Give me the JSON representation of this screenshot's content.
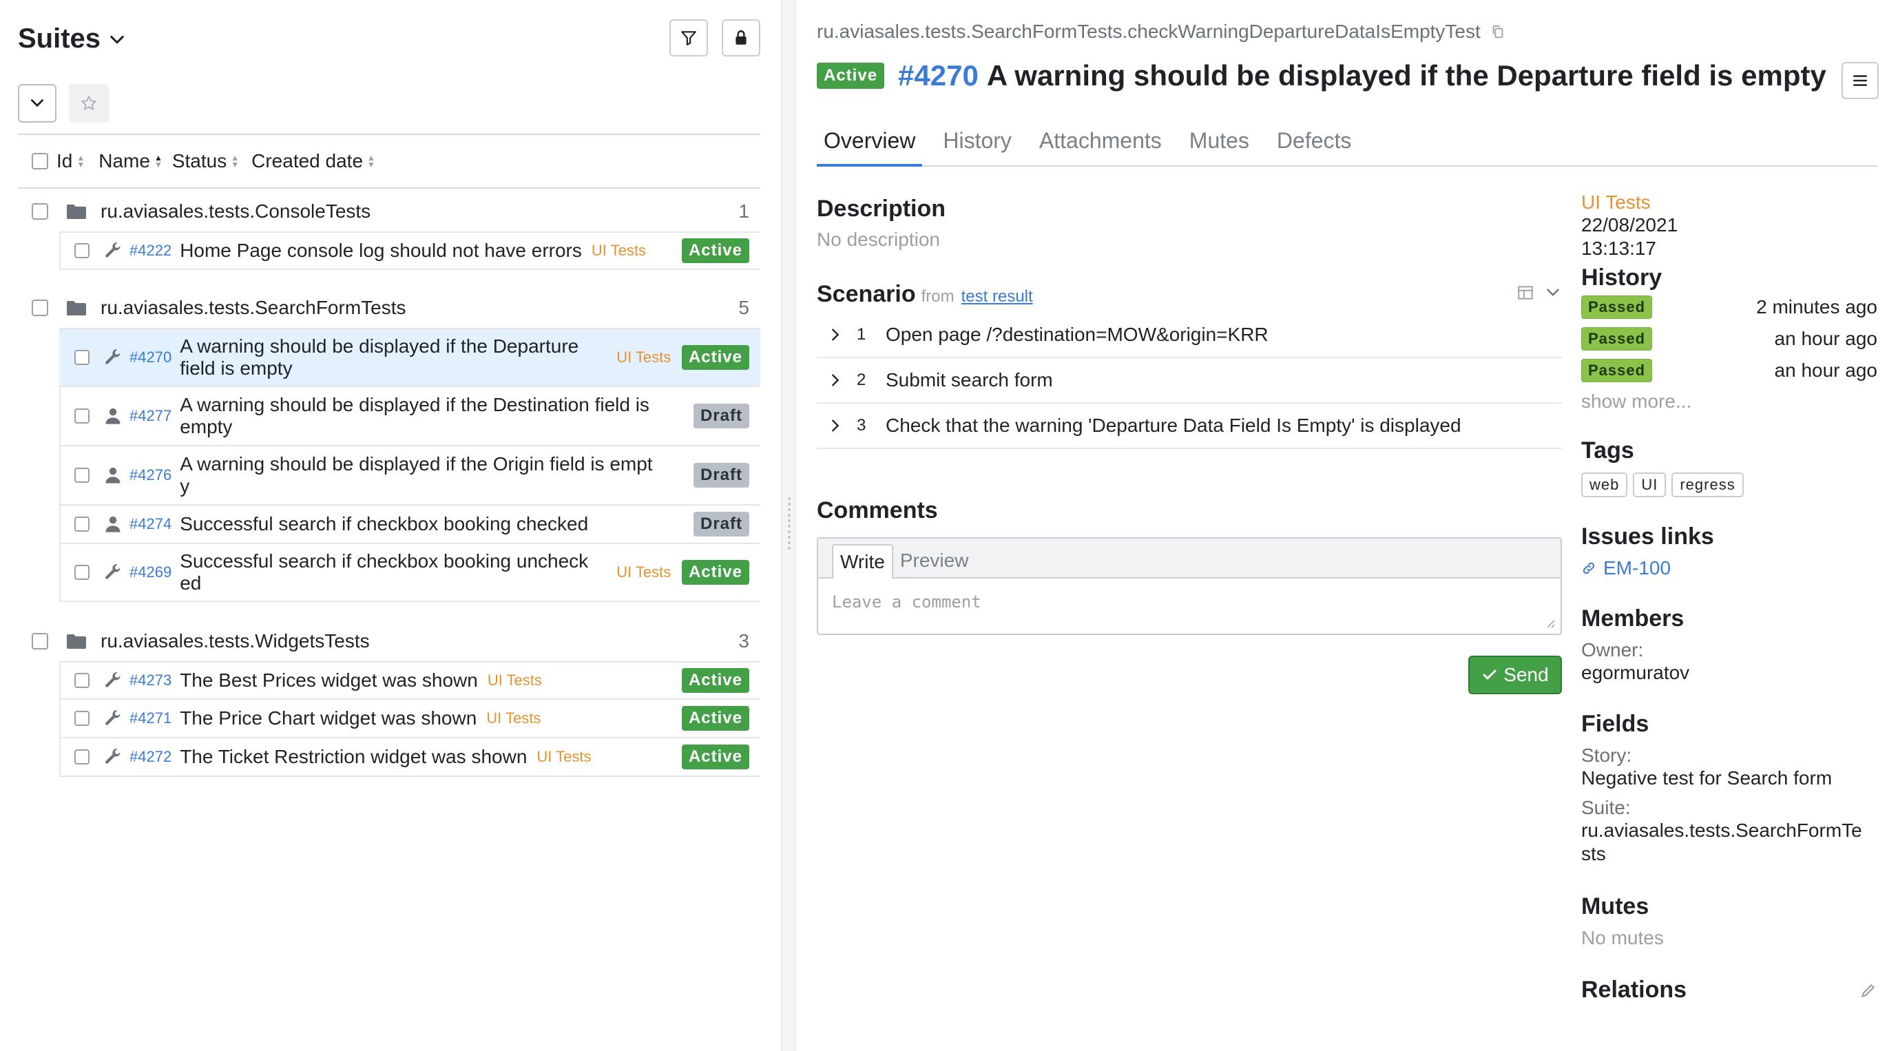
{
  "left": {
    "title": "Suites",
    "columns": [
      "Id",
      "Name",
      "Status",
      "Created date"
    ],
    "suites": [
      {
        "name": "ru.aviasales.tests.ConsoleTests",
        "count": "1",
        "cases": [
          {
            "id": "#4222",
            "name": "Home Page console log should not have errors",
            "layer": "UI Tests",
            "status": "Active",
            "icon": "wrench-icon"
          }
        ]
      },
      {
        "name": "ru.aviasales.tests.SearchFormTests",
        "count": "5",
        "cases": [
          {
            "id": "#4270",
            "name_line1": "A warning should be displayed if the Departure",
            "name_line2": "field is empty",
            "layer": "UI Tests",
            "status": "Active",
            "icon": "wrench-icon"
          },
          {
            "id": "#4277",
            "name_line1": "A warning should be displayed if the Destination field is",
            "name_line2": "empty",
            "layer": "",
            "status": "Draft",
            "icon": "person-icon"
          },
          {
            "id": "#4276",
            "name_line1": "A warning should be displayed if the Origin field is empt",
            "name_line2": "y",
            "layer": "",
            "status": "Draft",
            "icon": "person-icon"
          },
          {
            "id": "#4274",
            "name": "Successful search if checkbox booking checked",
            "layer": "",
            "status": "Draft",
            "icon": "person-icon"
          },
          {
            "id": "#4269",
            "name_line1": "Successful search if checkbox booking uncheck",
            "name_line2": "ed",
            "layer": "UI Tests",
            "status": "Active",
            "icon": "wrench-icon"
          }
        ]
      },
      {
        "name": "ru.aviasales.tests.WidgetsTests",
        "count": "3",
        "cases": [
          {
            "id": "#4273",
            "name": "The Best Prices widget was shown",
            "layer": "UI Tests",
            "status": "Active",
            "icon": "wrench-icon"
          },
          {
            "id": "#4271",
            "name": "The Price Chart widget was shown",
            "layer": "UI Tests",
            "status": "Active",
            "icon": "wrench-icon"
          },
          {
            "id": "#4272",
            "name": "The Ticket Restriction widget was shown",
            "layer": "UI Tests",
            "status": "Active",
            "icon": "wrench-icon"
          }
        ]
      }
    ]
  },
  "detail": {
    "full_name": "ru.aviasales.tests.SearchFormTests.checkWarningDepartureDataIsEmptyTest",
    "status": "Active",
    "id": "#4270",
    "title": "A warning should be displayed if the Departure field is empty",
    "tabs": [
      "Overview",
      "History",
      "Attachments",
      "Mutes",
      "Defects"
    ],
    "description_heading": "Description",
    "description": "No description",
    "scenario_heading": "Scenario",
    "scenario_from": "from",
    "scenario_link": "test result",
    "steps": [
      {
        "num": "1",
        "text": "Open page /?destination=MOW&origin=KRR"
      },
      {
        "num": "2",
        "text": "Submit search form"
      },
      {
        "num": "3",
        "text": "Check that the warning 'Departure Data Field Is Empty' is displayed"
      }
    ],
    "comments_heading": "Comments",
    "comment_tab_write": "Write",
    "comment_tab_preview": "Preview",
    "comment_placeholder": "Leave a comment",
    "send_label": "Send"
  },
  "side": {
    "layer": "UI Tests",
    "created_date": "22/08/2021",
    "created_time": "13:13:17",
    "history_heading": "History",
    "history": [
      {
        "status": "Passed",
        "time": "2 minutes ago"
      },
      {
        "status": "Passed",
        "time": "an hour ago"
      },
      {
        "status": "Passed",
        "time": "an hour ago"
      }
    ],
    "show_more": "show more...",
    "tags_heading": "Tags",
    "tags": [
      "web",
      "UI",
      "regress"
    ],
    "issues_heading": "Issues links",
    "issue": "EM-100",
    "members_heading": "Members",
    "owner_label": "Owner:",
    "owner": "egormuratov",
    "fields_heading": "Fields",
    "story_label": "Story:",
    "story": "Negative test for Search form",
    "suite_label": "Suite:",
    "suite_line1": "ru.aviasales.tests.SearchFormTe",
    "suite_line2": "sts",
    "mutes_heading": "Mutes",
    "mutes": "No mutes",
    "relations_heading": "Relations"
  },
  "colors": {
    "accent": "#3a7bd5",
    "active": "#43a047",
    "draft": "#b7bec6",
    "passed": "#8bc34a",
    "layer": "#e6922e",
    "selected_row": "#e3f0fd"
  }
}
